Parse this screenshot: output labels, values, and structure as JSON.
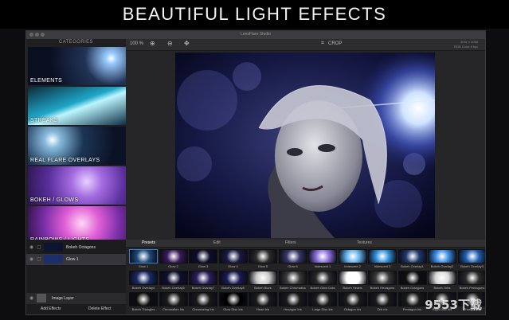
{
  "headline": "BEAUTIFUL LIGHT EFFECTS",
  "window": {
    "title": "LensFlare Studio"
  },
  "sidebar": {
    "title": "CATEGORIES",
    "items": [
      {
        "label": "ELEMENTS"
      },
      {
        "label": "STREAKS"
      },
      {
        "label": "REAL FLARE OVERLAYS"
      },
      {
        "label": "BOKEH / GLOWS"
      },
      {
        "label": "RAINBOWS / LIGHTS"
      }
    ]
  },
  "toolbar": {
    "zoom": "100 %",
    "crop_label": "CROP",
    "info_line1": "3041 x 3058",
    "info_line2": "RGB Color 8 bpc"
  },
  "layers": {
    "items": [
      {
        "label": "Bokeh Octagons"
      },
      {
        "label": "Glow 1"
      }
    ],
    "image_layer": "Image Layer",
    "add_button": "Add Effects",
    "delete_button": "Delete Effect"
  },
  "tabs": [
    "Presets",
    "Edit",
    "Filters",
    "Textures"
  ],
  "presets": {
    "row1": [
      "Glow 1",
      "Glow 2",
      "Glow 3",
      "Glow 4",
      "Glow 5",
      "Glow 6",
      "Iridescent 1",
      "Iridescent 2",
      "Iridescent 3",
      "Bokeh Overlay1",
      "Bokeh Overlay2",
      "Bokeh Overlay3"
    ],
    "row2": [
      "Bokeh Overlay4",
      "Bokeh Overlay5",
      "Bokeh Overlay7",
      "Bokeh Overlay8",
      "Bokeh Blurs",
      "Bokeh Chromatics",
      "Bokeh Glow Dots",
      "Bokeh Hearts",
      "Bokeh Hexagons",
      "Bokeh Octagons",
      "Bokeh Orbs",
      "Bokeh Pentagons"
    ],
    "row3": [
      "Bokeh Triangles",
      "Chromaflex Iris",
      "Chromaring Iris",
      "Glow Disc Iris",
      "Heart Iris",
      "Hexagon Iris",
      "Large Disc Iris",
      "Octagon Iris",
      "Orb Iris",
      "Pentagon Iris",
      "Rigid Disc Iris",
      "Triangle Iris"
    ]
  },
  "watermark": "9553下载",
  "colors": {
    "accent": "#3c7fd6",
    "background": "#0d0d0f"
  }
}
